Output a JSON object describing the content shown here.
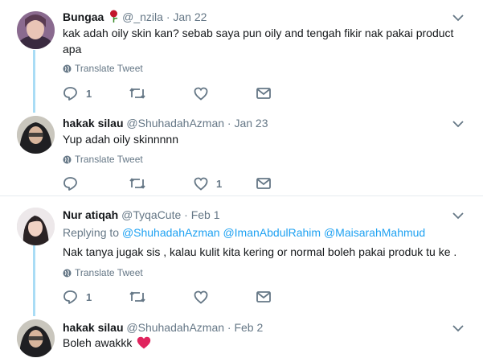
{
  "tweets": [
    {
      "name": "Bungaa",
      "handle": "@_nzila",
      "separator": "·",
      "date": "Jan 22",
      "text": "kak adah oily skin kan? sebab saya pun oily and tengah fikir nak pakai product apa",
      "translate": "Translate Tweet",
      "reply_count": "1",
      "retweet_count": "",
      "like_count": ""
    },
    {
      "name": "hakak silau",
      "handle": "@ShuhadahAzman",
      "separator": "·",
      "date": "Jan 23",
      "text": "Yup adah oily skinnnnn",
      "translate": "Translate Tweet",
      "reply_count": "",
      "retweet_count": "",
      "like_count": "1"
    },
    {
      "name": "Nur atiqah",
      "handle": "@TyqaCute",
      "separator": "·",
      "date": "Feb 1",
      "replying_prefix": "Replying to",
      "replying_to": [
        "@ShuhadahAzman",
        "@ImanAbdulRahim",
        "@MaisarahMahmud"
      ],
      "text": "Nak tanya jugak sis , kalau kulit kita kering or normal boleh pakai produk tu ke .",
      "translate": "Translate Tweet",
      "reply_count": "1",
      "retweet_count": "",
      "like_count": ""
    },
    {
      "name": "hakak silau",
      "handle": "@ShuhadahAzman",
      "separator": "·",
      "date": "Feb 2",
      "text": "Boleh awakkk"
    }
  ],
  "colors": {
    "accent": "#1da1f2",
    "thread_line": "#a9dcf5",
    "muted": "#657786",
    "heart_emoji": "#e0245e",
    "rose_emoji": "#c2162b"
  },
  "icons": [
    "rose-emoji-icon",
    "globe-icon",
    "reply-icon",
    "retweet-icon",
    "like-icon",
    "share-dm-icon",
    "chevron-down-icon",
    "heart-emoji-icon"
  ]
}
